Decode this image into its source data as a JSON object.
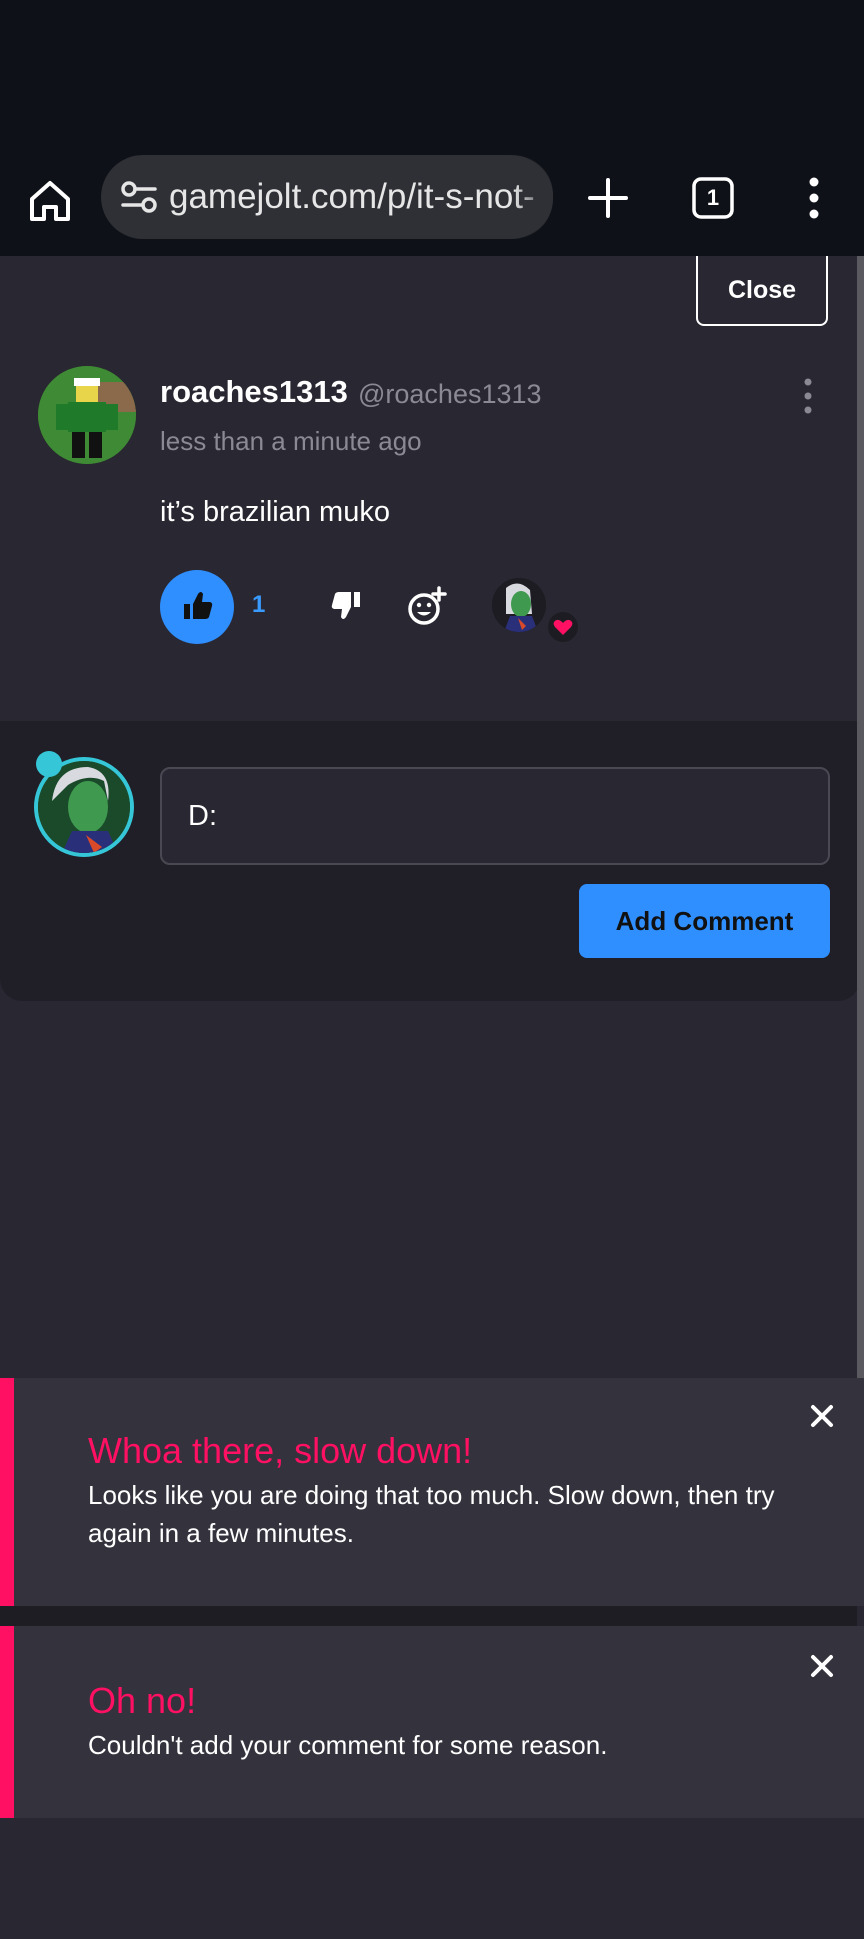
{
  "browser": {
    "url": "gamejolt.com/p/it-s-not-",
    "tab_count": "1",
    "home_icon": "home-icon",
    "tune_icon": "tune-icon",
    "new_tab_icon": "plus-icon",
    "menu_icon": "more-vertical-icon"
  },
  "dialog": {
    "close_label": "Close"
  },
  "comment": {
    "username": "roaches1313",
    "handle": "@roaches1313",
    "timestamp": "less than a minute ago",
    "text": "it’s brazilian muko",
    "like_count": "1",
    "like_icon": "thumbs-up-icon",
    "dislike_icon": "thumbs-down-icon",
    "reaction_icon": "add-reaction-icon"
  },
  "form": {
    "input_value": "D:",
    "submit_label": "Add Comment"
  },
  "toasts": [
    {
      "title": "Whoa there, slow down!",
      "message": "Looks like you are doing that too much. Slow down, then try again in a few minutes."
    },
    {
      "title": "Oh no!",
      "message": "Couldn't add your comment for some reason."
    }
  ],
  "colors": {
    "accent": "#2f8fff",
    "error": "#ff1062",
    "background": "#292731",
    "toolbar": "#0e1117"
  }
}
